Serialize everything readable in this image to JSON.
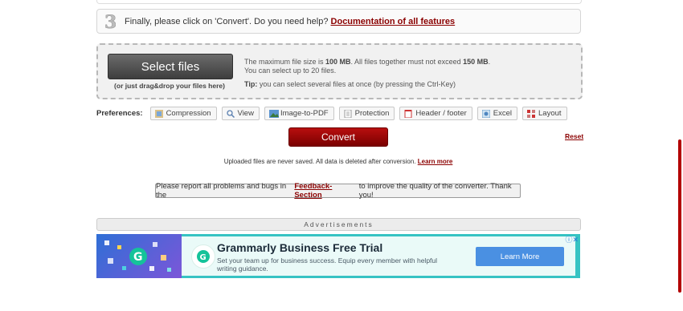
{
  "step3": {
    "number": "3",
    "text": "Finally, please click on 'Convert'. Do you need help?",
    "link": "Documentation of all features"
  },
  "upload": {
    "button_label": "Select files",
    "drag_hint": "(or just drag&drop your files here)",
    "info_line1_a": "The maximum file size is ",
    "info_line1_b": "100 MB",
    "info_line1_c": ". All files together must not exceed ",
    "info_line1_d": "150 MB",
    "info_line1_e": ".",
    "info_line2": "You can select up to 20 files.",
    "tip_label": "Tip:",
    "tip_text": " you can select several files at once (by pressing the Ctrl-Key)"
  },
  "preferences": {
    "label": "Preferences:",
    "items": [
      {
        "label": "Compression",
        "icon": "compression-icon"
      },
      {
        "label": "View",
        "icon": "view-icon"
      },
      {
        "label": "Image-to-PDF",
        "icon": "image-icon"
      },
      {
        "label": "Protection",
        "icon": "protection-icon"
      },
      {
        "label": "Header / footer",
        "icon": "header-footer-icon"
      },
      {
        "label": "Excel",
        "icon": "excel-icon"
      },
      {
        "label": "Layout",
        "icon": "layout-icon"
      }
    ]
  },
  "convert_label": "Convert",
  "reset_label": "Reset",
  "privacy": {
    "text": "Uploaded files are never saved. All data is deleted after conversion.",
    "link": "Learn more"
  },
  "report": {
    "text_a": "Please report all problems and bugs in the",
    "link": "Feedback-Section",
    "text_b": "to improve the quality of the converter. Thank you!"
  },
  "ads_label": "Advertisements",
  "ad": {
    "title": "Grammarly Business Free Trial",
    "description": "Set your team up for business success. Equip every member with helpful writing guidance.",
    "cta": "Learn More",
    "brand_color": "#15c39a",
    "cta_color": "#4a90e2"
  },
  "colors": {
    "accent": "#8b0000",
    "convert": "#a00a0a"
  }
}
